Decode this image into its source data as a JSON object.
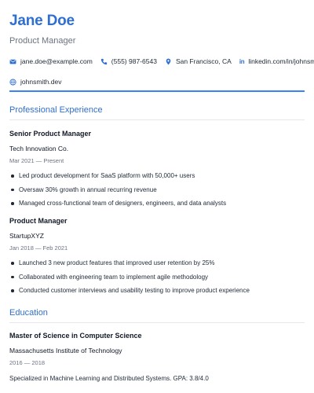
{
  "header": {
    "name": "Jane Doe",
    "title": "Product Manager"
  },
  "contacts": {
    "email": "jane.doe@example.com",
    "phone": "(555) 987-6543",
    "location": "San Francisco, CA",
    "linkedin_prefix": "in",
    "linkedin": "linkedin.com/in/johnsmith",
    "website": "johnsmith.dev"
  },
  "colors": {
    "accent": "#2f6fd1",
    "rule": "#3b82f6"
  },
  "sections": {
    "experience_title": "Professional Experience",
    "education_title": "Education"
  },
  "experience": [
    {
      "role": "Senior Product Manager",
      "company": "Tech Innovation Co.",
      "dates": "Mar 2021 — Present",
      "bullets": [
        "Led product development for SaaS platform with 50,000+ users",
        "Oversaw 30% growth in annual recurring revenue",
        "Managed cross-functional team of designers, engineers, and data analysts"
      ]
    },
    {
      "role": "Product Manager",
      "company": "StartupXYZ",
      "dates": "Jan 2018 — Feb 2021",
      "bullets": [
        "Launched 3 new product features that improved user retention by 25%",
        "Collaborated with engineering team to implement agile methodology",
        "Conducted customer interviews and usability testing to improve product experience"
      ]
    }
  ],
  "education": [
    {
      "degree": "Master of Science in Computer Science",
      "school": "Massachusetts Institute of Technology",
      "dates": "2016 — 2018",
      "description": "Specialized in Machine Learning and Distributed Systems. GPA: 3.8/4.0"
    }
  ]
}
